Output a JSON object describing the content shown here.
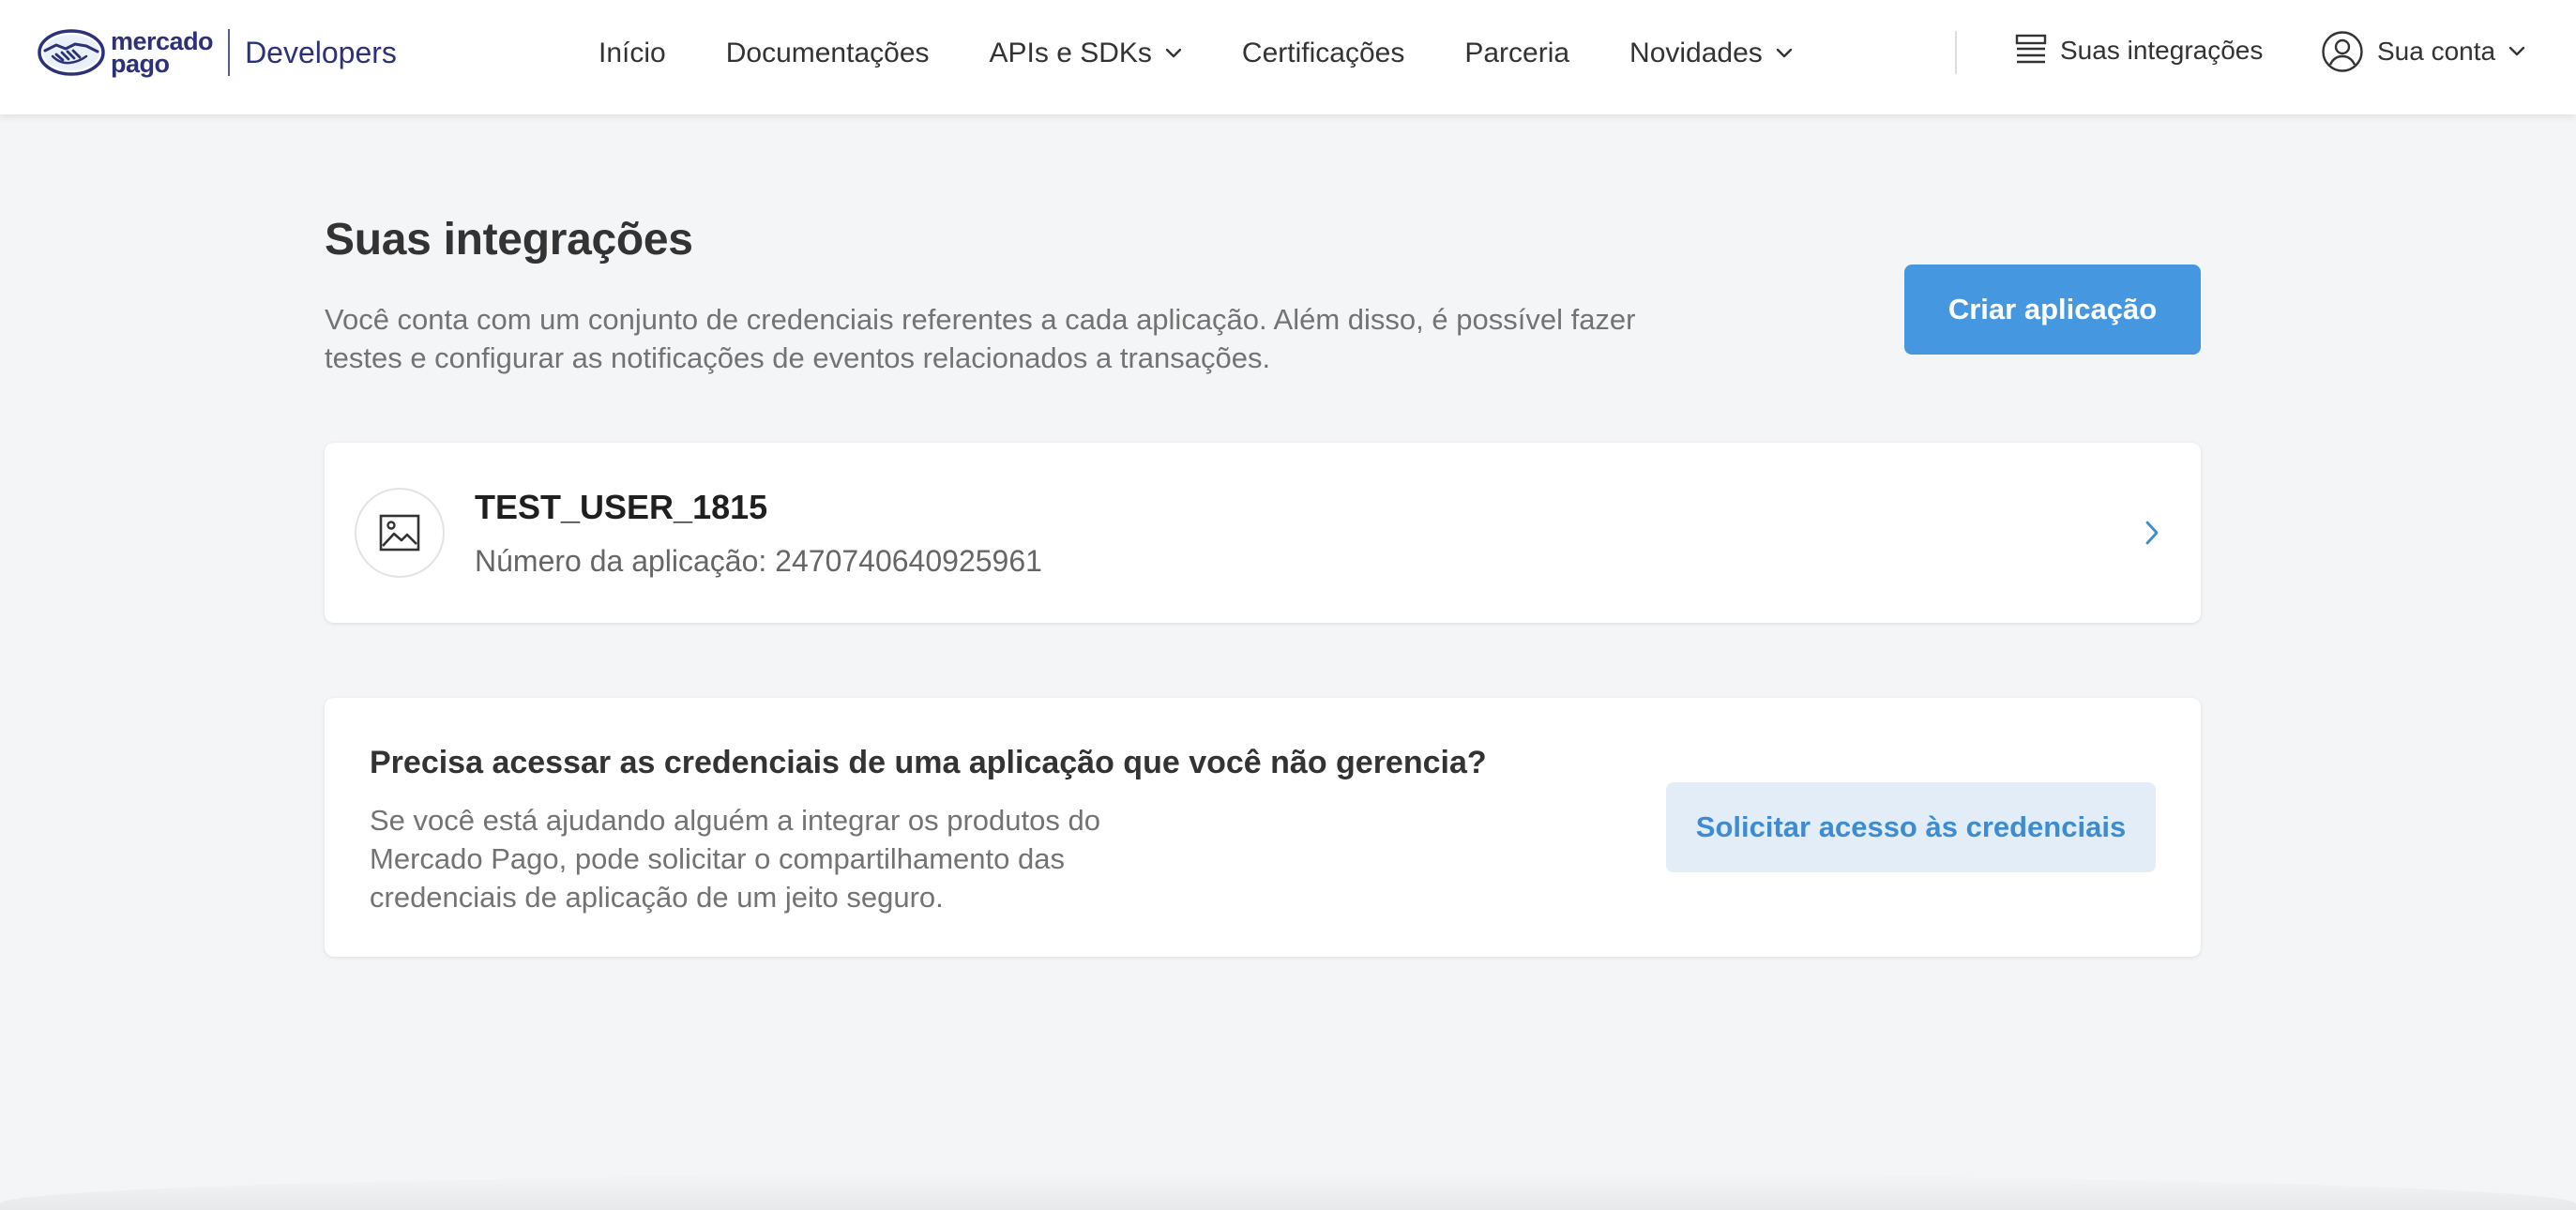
{
  "brand": {
    "logo_text_line1": "mercado",
    "logo_text_line2": "pago",
    "product": "Developers",
    "color": "#2d3277"
  },
  "nav": {
    "items": [
      {
        "label": "Início",
        "has_dropdown": false
      },
      {
        "label": "Documentações",
        "has_dropdown": false
      },
      {
        "label": "APIs e SDKs",
        "has_dropdown": true
      },
      {
        "label": "Certificações",
        "has_dropdown": false
      },
      {
        "label": "Parceria",
        "has_dropdown": false
      },
      {
        "label": "Novidades",
        "has_dropdown": true
      }
    ],
    "integrations_label": "Suas integrações",
    "integrations_icon": "list-icon",
    "account_label": "Sua conta",
    "account_icon": "user-icon"
  },
  "main": {
    "title": "Suas integrações",
    "description": "Você conta com um conjunto de credenciais referentes a cada aplicação. Além disso, é possível fazer testes e configurar as notificações de eventos relacionados a transações.",
    "create_button": "Criar aplicação",
    "applications": [
      {
        "name": "TEST_USER_1815",
        "number_label": "Número da aplicação:",
        "number": "2470740640925961",
        "icon": "image-placeholder-icon"
      }
    ],
    "access_card": {
      "title": "Precisa acessar as credenciais de uma aplicação que você não gerencia?",
      "text": "Se você está ajudando alguém a integrar os produtos do Mercado Pago, pode solicitar o compartilhamento das credenciais de aplicação de um jeito seguro.",
      "button": "Solicitar acesso às credenciais"
    }
  },
  "colors": {
    "primary": "#4598e0",
    "secondary_bg": "#e3edf8",
    "secondary_text": "#3d8bd0",
    "page_bg": "#f4f5f7"
  }
}
